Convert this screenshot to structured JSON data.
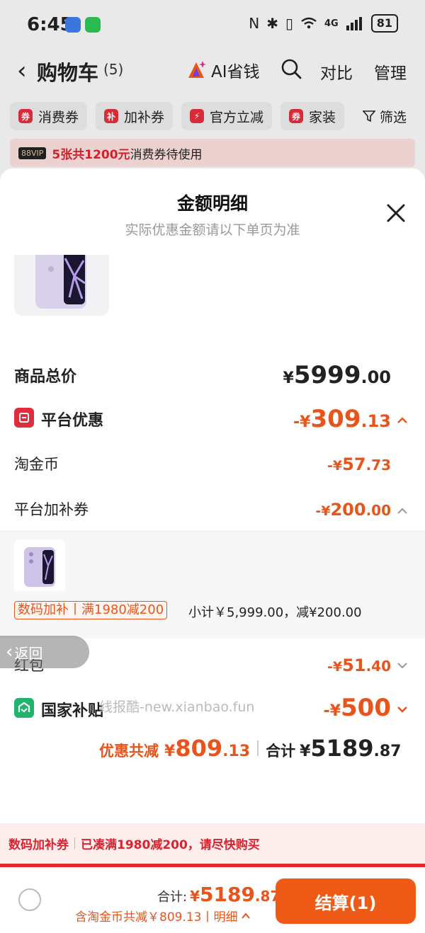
{
  "status_bar": {
    "time": "6:45",
    "network": "4G",
    "battery": "81"
  },
  "cart_header": {
    "title": "购物车",
    "count": "(5)",
    "ai_save_label": "AI省钱",
    "compare_label": "对比",
    "manage_label": "管理"
  },
  "chips": [
    {
      "icon": "券",
      "label": "消费券"
    },
    {
      "icon": "补",
      "label": "加补券"
    },
    {
      "icon": "⚡",
      "label": "官方立减"
    },
    {
      "icon": "券",
      "label": "家装"
    }
  ],
  "filter_label": "筛选",
  "vip_banner": {
    "badge": "88VIP",
    "strong": "5张共1200元",
    "rest": "消费券待使用"
  },
  "sheet": {
    "title": "金额明细",
    "subtitle": "实际优惠金额请以下单页为准"
  },
  "rows": {
    "total_price": {
      "label": "商品总价",
      "yen": "¥",
      "int": "5999",
      "dec": ".00"
    },
    "platform_discount": {
      "label": "平台优惠",
      "yen": "-¥",
      "int": "309",
      "dec": ".13"
    },
    "taojinbi": {
      "label": "淘金币",
      "yen": "-¥",
      "int": "57",
      "dec": ".73"
    },
    "platform_coupon": {
      "label": "平台加补券",
      "yen": "-¥",
      "int": "200",
      "dec": ".00"
    },
    "red_packet": {
      "label": "红包",
      "yen": "-¥",
      "int": "51",
      "dec": ".40"
    },
    "national_subsidy": {
      "label": "国家补贴",
      "yen": "-¥",
      "int": "500",
      "dec": ""
    }
  },
  "subsidy_item": {
    "tag": "数码加补丨满1980减200",
    "summary": "小计￥5,999.00，减¥200.00"
  },
  "back_pill": "返回",
  "watermark": "线报酷-new.xianbao.fun",
  "totals": {
    "discount_label": "优惠共减",
    "discount_yen": "¥",
    "discount_int": "809",
    "discount_dec": ".13",
    "sum_label": "合计",
    "sum_yen": "¥",
    "sum_int": "5189",
    "sum_dec": ".87"
  },
  "coupon_tip": {
    "strong": "数码加补券",
    "rest": "已凑满1980减200，请尽快购买"
  },
  "checkout": {
    "total_label": "合计:",
    "yen": "¥",
    "int": "5189",
    "dec": ".87",
    "detail": "含淘金币共减￥809.13丨明细",
    "button": "结算(1)"
  },
  "colors": {
    "accent_orange": "#e8541a",
    "brand_red": "#e8262f",
    "subsidy_green": "#1fb36b"
  }
}
